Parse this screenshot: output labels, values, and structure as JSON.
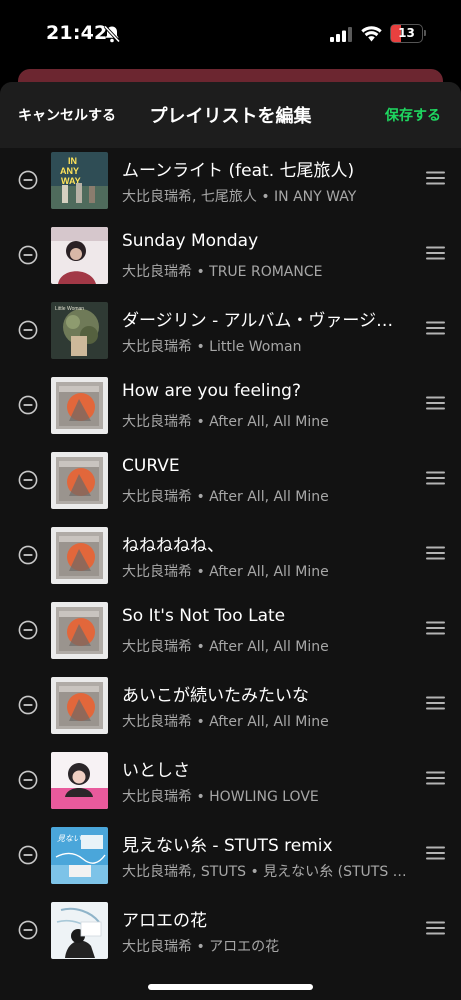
{
  "status_bar": {
    "time": "21:42",
    "battery": "13",
    "icons": [
      "bell-slash-icon",
      "cellular-signal-icon",
      "wifi-icon",
      "battery-icon"
    ]
  },
  "header": {
    "cancel_label": "キャンセルする",
    "title": "プレイリストを編集",
    "save_label": "保存する"
  },
  "colors": {
    "accent": "#1ed760",
    "background": "#121212",
    "header_bg": "#1d1d1d",
    "subtext": "#a7a7a7",
    "battery_low": "#e8403f"
  },
  "tracks": [
    {
      "title": "ムーンライト (feat. 七尾旅人)",
      "subtitle": "大比良瑞希, 七尾旅人 • IN ANY WAY",
      "art": "in-any-way"
    },
    {
      "title": "Sunday Monday",
      "subtitle": "大比良瑞希 • TRUE ROMANCE",
      "art": "true-romance"
    },
    {
      "title": "ダージリン - アルバム・ヴァージョン",
      "subtitle": "大比良瑞希 • Little Woman",
      "art": "little-woman"
    },
    {
      "title": "How are you feeling?",
      "subtitle": "大比良瑞希 • After All, All Mine",
      "art": "after-all"
    },
    {
      "title": "CURVE",
      "subtitle": "大比良瑞希 • After All, All Mine",
      "art": "after-all"
    },
    {
      "title": "ねねねねね、",
      "subtitle": "大比良瑞希 • After All, All Mine",
      "art": "after-all"
    },
    {
      "title": "So It's Not Too Late",
      "subtitle": "大比良瑞希 • After All, All Mine",
      "art": "after-all"
    },
    {
      "title": "あいこが続いたみたいな",
      "subtitle": "大比良瑞希 • After All, All Mine",
      "art": "after-all"
    },
    {
      "title": "いとしさ",
      "subtitle": "大比良瑞希 • HOWLING LOVE",
      "art": "howling-love"
    },
    {
      "title": "見えない糸 - STUTS remix",
      "subtitle": "大比良瑞希, STUTS • 見えない糸 (STUTS remix)",
      "art": "mienai-ito"
    },
    {
      "title": "アロエの花",
      "subtitle": "大比良瑞希 • アロエの花",
      "art": "aloe"
    }
  ]
}
